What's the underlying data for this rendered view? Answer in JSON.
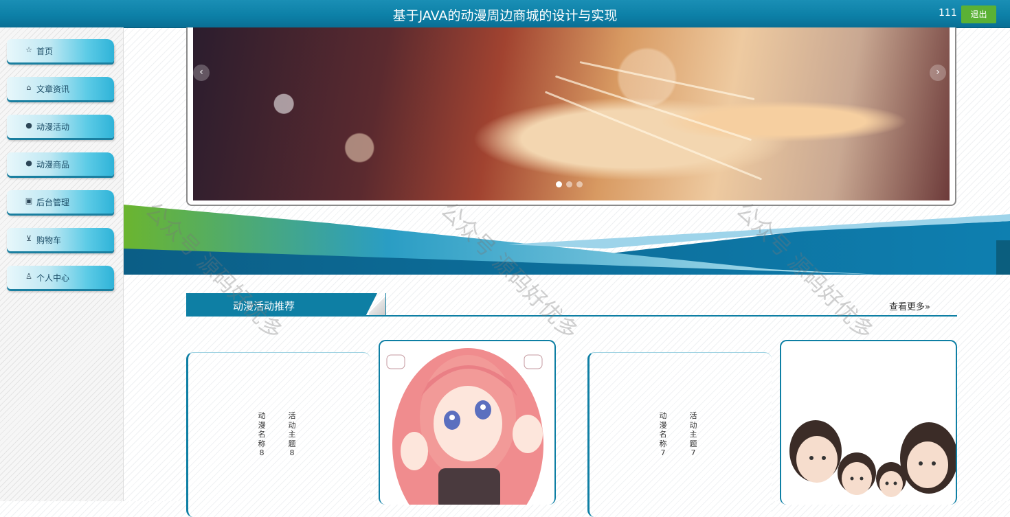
{
  "header": {
    "title": "基于JAVA的动漫周边商城的设计与实现",
    "username": "111",
    "logout_label": "退出"
  },
  "sidebar": {
    "items": [
      {
        "label": "首页",
        "icon": "star-icon",
        "glyph": "☆"
      },
      {
        "label": "文章资讯",
        "icon": "bag-icon",
        "glyph": "⌂"
      },
      {
        "label": "动漫活动",
        "icon": "info-icon",
        "glyph": "●"
      },
      {
        "label": "动漫商品",
        "icon": "help-icon",
        "glyph": "●"
      },
      {
        "label": "后台管理",
        "icon": "box-icon",
        "glyph": "▣"
      },
      {
        "label": "购物车",
        "icon": "cart-icon",
        "glyph": "⊻"
      },
      {
        "label": "个人中心",
        "icon": "user-icon",
        "glyph": "♙"
      }
    ]
  },
  "carousel": {
    "prev_glyph": "‹",
    "next_glyph": "›"
  },
  "section": {
    "title": "动漫活动推荐",
    "more_label": "查看更多»"
  },
  "cards": [
    {
      "name": "动漫名称8",
      "theme": "活动主题8"
    },
    {
      "name": "动漫名称7",
      "theme": "活动主题7"
    }
  ],
  "watermark": "公众号 源码好优多",
  "colors": {
    "header_bg": "#0c7fa6",
    "accent": "#0e7fa4",
    "logout_bg": "#5ab135"
  }
}
